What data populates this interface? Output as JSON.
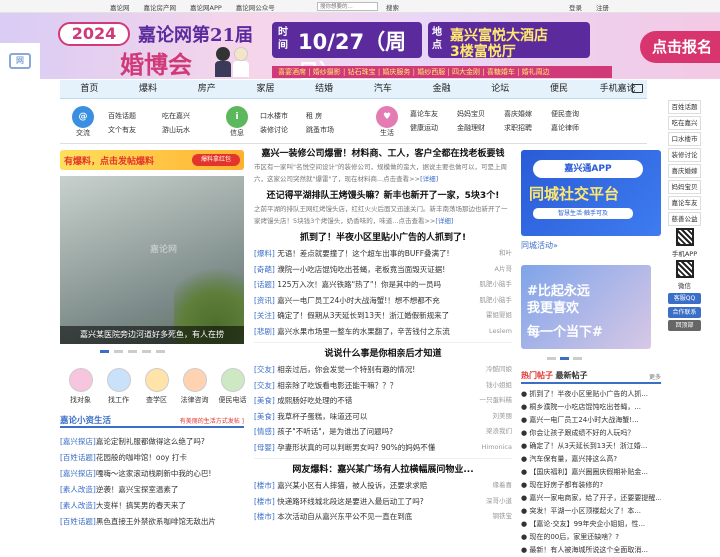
{
  "topbar": {
    "links": [
      "嘉论网",
      "嘉论房产网",
      "嘉论网APP",
      "嘉论网公众号"
    ],
    "search_placeholder": "搜你想要的...",
    "search_button": "搜索",
    "login": "登录",
    "register": "注册"
  },
  "banner": {
    "year": "2024",
    "title1": "嘉论网第21届",
    "title2": "婚博会",
    "time_label": "时间",
    "date": "10/27（周日）",
    "place_label": "地点",
    "venue1": "嘉兴富悦大酒店",
    "venue2": "3楼富悦厅",
    "cta": "点击报名",
    "strip": "喜宴酒席 | 婚纱摄影 | 钻石珠宝 | 婚庆服务 | 婚纱西服 | 四大金刚 | 喜糖婚车 | 婚礼周边"
  },
  "mainnav": [
    "首页",
    "爆料",
    "房产",
    "家居",
    "结婚",
    "汽车",
    "金融",
    "论坛",
    "便民",
    "手机嘉论"
  ],
  "subnav": [
    {
      "label": "交流",
      "color": "#3b8fe0",
      "links": [
        "百姓话题",
        "吃在嘉兴",
        "文个有友",
        "游山玩水"
      ]
    },
    {
      "label": "信息",
      "color": "#5cb85c",
      "links": [
        "口水楼市",
        "租 房",
        "装修讨论",
        "跳蚤市场"
      ]
    },
    {
      "label": "生活",
      "color": "#e57bb3",
      "links": [
        "嘉论车友",
        "妈妈宝贝",
        "喜庆婚嫁",
        "便民查询",
        "健康运动",
        "金融理财",
        "求职招聘",
        "嘉论律师"
      ]
    }
  ],
  "sidebar": {
    "items": [
      "百姓话题",
      "吃在嘉兴",
      "口水楼市",
      "装修讨论",
      "喜庆婚嫁",
      "妈妈宝贝",
      "嘉论车友",
      "慈善公益"
    ],
    "qr1": "手机APP",
    "qr2": "微信",
    "service": "客服QQ",
    "coop": "合作联系",
    "top": "回顶部"
  },
  "left": {
    "ad_title": "有爆料，点击发帖爆料",
    "ad_pill": "爆料拿红包",
    "photo_caption": "嘉兴某医院旁边河道好多死鱼，有人在捞",
    "photo_watermark": "嘉论网",
    "icons": [
      {
        "label": "找对象",
        "color": "#f7c6de"
      },
      {
        "label": "找工作",
        "color": "#c9e2fa"
      },
      {
        "label": "查学区",
        "color": "#ffe3a8"
      },
      {
        "label": "法律咨询",
        "color": "#ffd3b2"
      },
      {
        "label": "便民电话",
        "color": "#cde8c3"
      }
    ],
    "life_title": "嘉论小资生活",
    "life_right": "有美丽的生活方式发帖 ]",
    "life_items": [
      {
        "tag": "[嘉兴探店]",
        "text": "嘉论定制礼服都做得这么绝了吗?"
      },
      {
        "tag": "[百姓话题]",
        "text": "花园般的咖啡馆！ooy 打卡"
      },
      {
        "tag": "[嘉兴探店]",
        "text": "嘎嗨～这家滚动栈刷新中我的心巴!"
      },
      {
        "tag": "[素人改造]",
        "text": "逆袭！嘉兴宝探室温素了"
      },
      {
        "tag": "[素人改造]",
        "text": "大变样！搞笑男的春天来了"
      },
      {
        "tag": "[百姓话题]",
        "text": "黑色直接王外禁欲系咖啡馆无敌出片"
      }
    ]
  },
  "center": {
    "headline1": "嘉兴一装修公司爆雷！材料商、工人，客户全都在找老板要钱",
    "desc1": "市区有一家叫\"名悦空间设计\"的装修公司，规模做的蛮大，据说主要也做可以，可是上周六，这家公司突然就\"爆雷\"了，现在材料商...点击查看>>",
    "more1": "[详细]",
    "headline2": "还记得平湖排队王烤馒头嘛？新丰也新开了一家，5块3个!",
    "desc2": "之前平湖的排队王网红烤馒头店，红红火火后面又迅速关门。新丰南荡场那边也新开了一家烤馒头店！5块钱3个烤馒头，奶香味的，味道...点击查看>>",
    "more2": "[详细]",
    "headline3": "抓到了！半夜小区里贴小广告的人抓到了!",
    "list1": [
      {
        "tag": "[爆料]",
        "text": "无语！差点就要撞了！这个超车出事的BUFF叠满了!",
        "author": "和叶"
      },
      {
        "tag": "[奇葩]",
        "text": "濮院一小吃店馄饨吃出苍蝇，老板竟当面毁灭证据!",
        "author": "A片哥"
      },
      {
        "tag": "[话题]",
        "text": "125万入次！嘉兴铁路\"热了\"！你是其中的一员吗",
        "author": "肌肥小脑手"
      },
      {
        "tag": "[资讯]",
        "text": "嘉兴一电厂员工24小时大战海蟹!！想不想都不充",
        "author": "肌肥小脑手"
      },
      {
        "tag": "[关注]",
        "text": "确定了！假期从3天延长到13天！浙江婚假新规来了",
        "author": "霍姐婴姐"
      },
      {
        "tag": "[悲剧]",
        "text": "嘉兴水果市场里一整车的水果翻了，辛苦钱付之东流",
        "author": "Leslem"
      }
    ],
    "headline4": "说说什么事是你相亲后才知道",
    "list2": [
      {
        "tag": "[交友]",
        "text": "相亲过后，你会发觉一个特别有趣的情况!",
        "author": "冷酷同娘"
      },
      {
        "tag": "[交友]",
        "text": "相亲除了吃饭看电影还能干嘛？？？",
        "author": "钱小姐姐"
      },
      {
        "tag": "[美食]",
        "text": "成熙肠好吃处理的不错",
        "author": "一只蛋料糕"
      },
      {
        "tag": "[美食]",
        "text": "我草杯子蛋糕，味道还可以",
        "author": "刘美丽"
      },
      {
        "tag": "[情感]",
        "text": "孩子\"不听话\"，是为谁出了问题吗?",
        "author": "梁浪我们"
      },
      {
        "tag": "[母婴]",
        "text": "孕妻形状真的可以判断男女吗? 90%的妈妈不懂",
        "author": "Himonica"
      }
    ],
    "headline5": "网友爆料：嘉兴某广场有人拉横幅展问物业...",
    "list3": [
      {
        "tag": "[楼市]",
        "text": "嘉兴某小区有人摔猫，被人投诉，还要求求赔",
        "author": "缘着喜"
      },
      {
        "tag": "[楼市]",
        "text": "快递路环线城北段这是要进入最后动工了吗?",
        "author": "深哥小道"
      },
      {
        "tag": "[楼市]",
        "text": "本次活动自从嘉兴东平公不见一直在到底",
        "author": "钢铁宝"
      }
    ]
  },
  "right": {
    "app_title": "嘉兴通APP",
    "app_main": "同城社交平台",
    "app_sub": "智慧生活·触手可及",
    "app_caption": "同城活动»",
    "wed_line1": "#比起永远",
    "wed_line2": "我更喜欢",
    "wed_line3": "每一个当下#",
    "hot_title1": "热门帖子",
    "hot_title2": "最新帖子",
    "hot_more": "更多",
    "hot_items": [
      "抓到了！半夜小区里贴小广告的人抓...",
      "桐乡濮院一小吃店馄饨吃出苍蝇，...",
      "嘉兴一电厂员工24小时大战海蟹!...",
      "你会让孩子跟成绩不好的人玩吗？",
      "确定了！从3天延长到13天！浙江婚...",
      "汽车保有量，嘉兴排这么高?",
      "【国庆福利】嘉兴圈圈庆假期补贴金...",
      "现在好房子都有装修的?",
      "嘉兴一家电商家，给了开子，还要要提醒...",
      "突发！平湖一小区顶楼起火了！本...",
      "【嘉论·交友】99年央企小姐姐，性...",
      "现在的00后，家里还缺啥？?",
      "最新！有人被海城所说这个全面取消..."
    ]
  }
}
